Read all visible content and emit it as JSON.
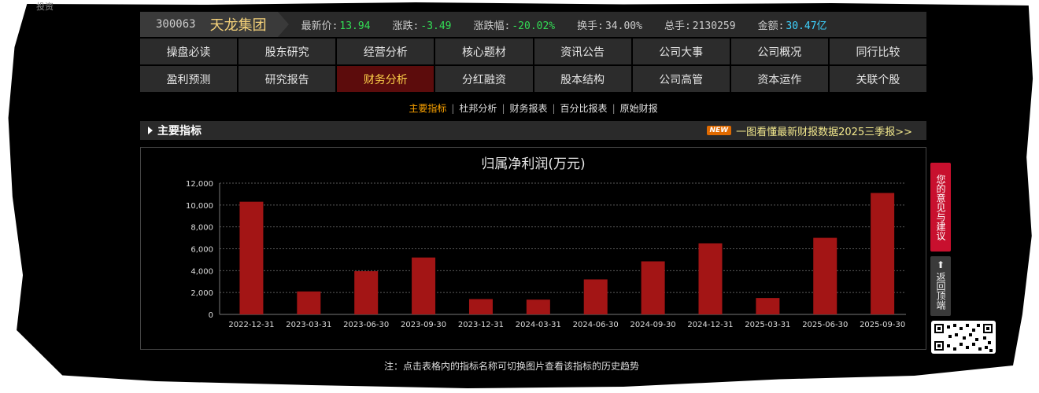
{
  "header": {
    "code": "300063",
    "name": "天龙集团",
    "stats": [
      {
        "label": "最新价:",
        "value": "13.94",
        "color": "#33dd55"
      },
      {
        "label": "涨跌:",
        "value": "-3.49",
        "color": "#33dd55"
      },
      {
        "label": "涨跌幅:",
        "value": "-20.02%",
        "color": "#33dd55"
      },
      {
        "label": "换手:",
        "value": "34.00%",
        "color": "#cccccc"
      },
      {
        "label": "总手:",
        "value": "2130259",
        "color": "#cccccc"
      },
      {
        "label": "金额:",
        "value": "30.47亿",
        "color": "#3fd3ff"
      }
    ]
  },
  "nav": {
    "row1": [
      "操盘必读",
      "股东研究",
      "经营分析",
      "核心题材",
      "资讯公告",
      "公司大事",
      "公司概况",
      "同行比较"
    ],
    "row2": [
      "盈利预测",
      "研究报告",
      "财务分析",
      "分红融资",
      "股本结构",
      "公司高管",
      "资本运作",
      "关联个股"
    ],
    "active": "财务分析"
  },
  "subnav": {
    "items": [
      "主要指标",
      "杜邦分析",
      "财务报表",
      "百分比报表",
      "原始财报"
    ],
    "current": "主要指标"
  },
  "section": {
    "title": "主要指标",
    "badge": "NEW",
    "promo": "一图看懂最新财报数据2025三季报>>"
  },
  "chart_data": {
    "type": "bar",
    "title": "归属净利润(万元)",
    "categories": [
      "2022-12-31",
      "2023-03-31",
      "2023-06-30",
      "2023-09-30",
      "2023-12-31",
      "2024-03-31",
      "2024-06-30",
      "2024-09-30",
      "2024-12-31",
      "2025-03-31",
      "2025-06-30",
      "2025-09-30"
    ],
    "values": [
      10300,
      2100,
      3950,
      5200,
      1400,
      1350,
      3200,
      4850,
      6500,
      1500,
      7000,
      11100
    ],
    "ylim": [
      0,
      12000
    ],
    "yticks": [
      "0",
      "2,000",
      "4,000",
      "6,000",
      "8,000",
      "10,000",
      "12,000"
    ],
    "grid": true,
    "bar_color": "#a31515"
  },
  "note": "注：点击表格内的指标名称可切换图片查看该指标的历史趋势",
  "sidebar": {
    "feedback": "您的意见与建议",
    "backtop": "返回顶端"
  },
  "scraps": {
    "top_left": "投资"
  }
}
